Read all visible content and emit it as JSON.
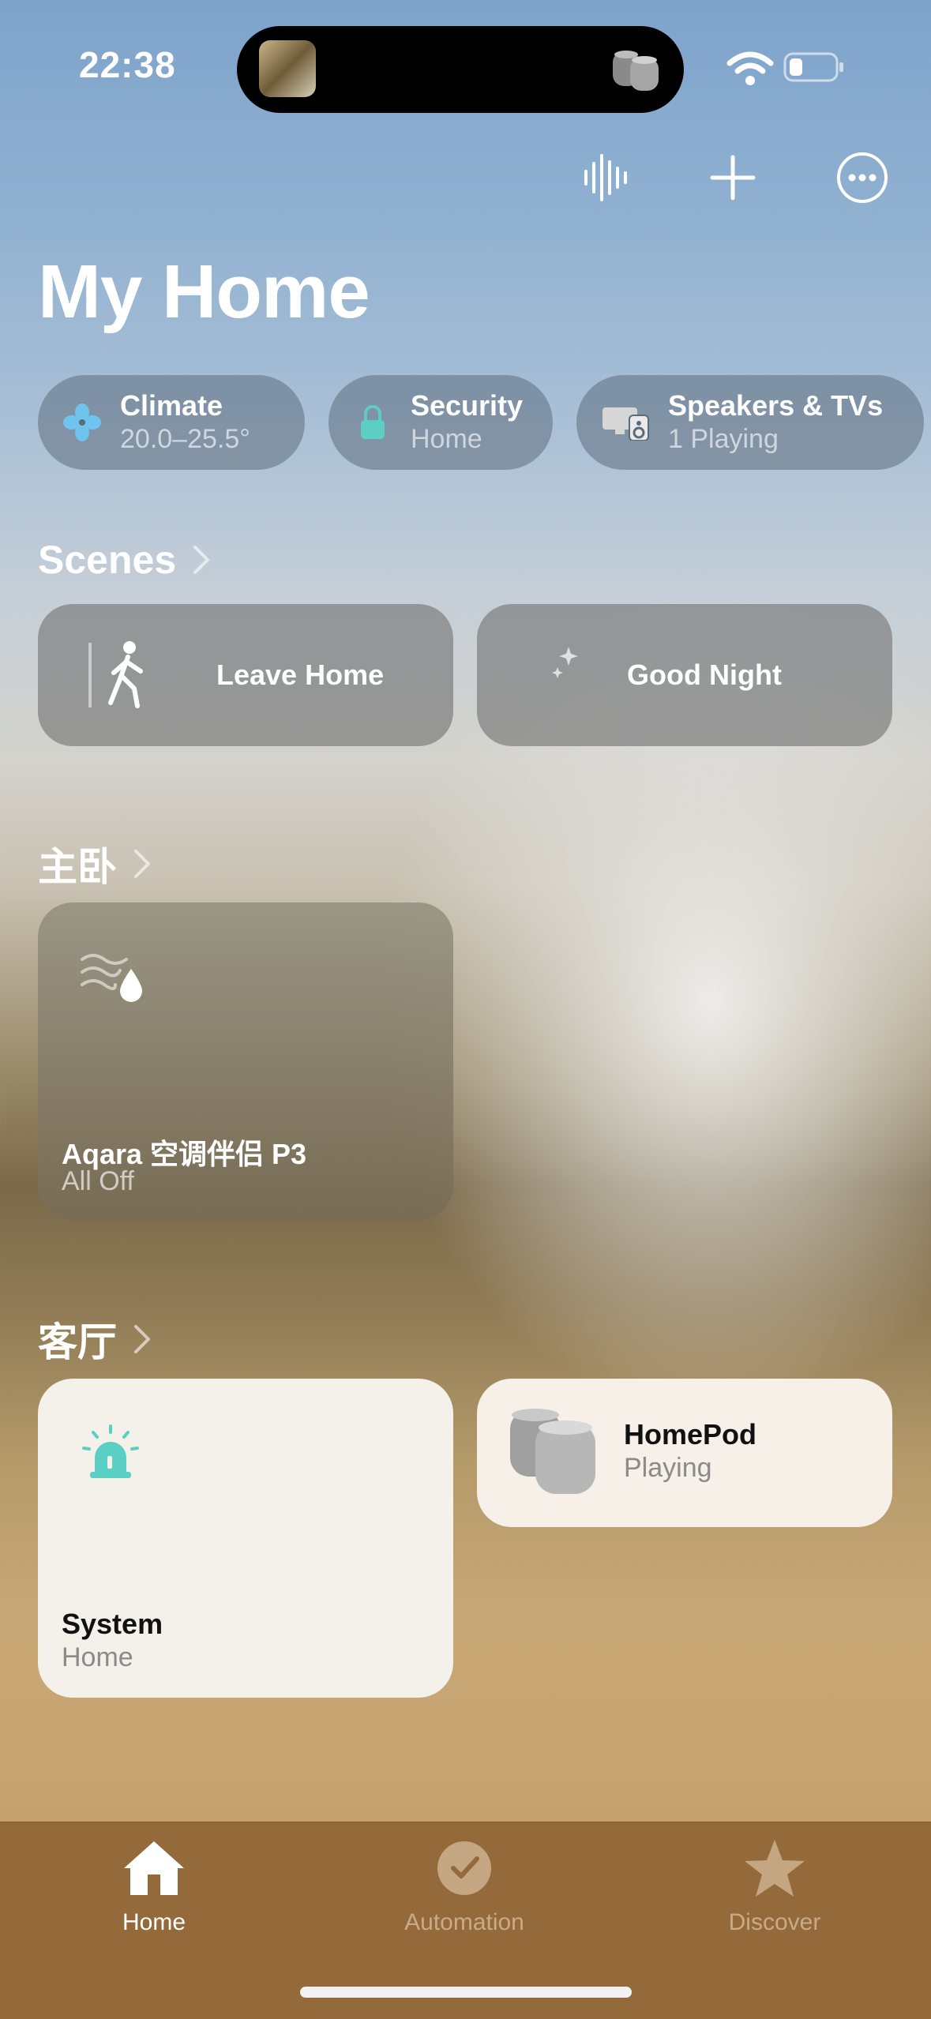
{
  "status_bar": {
    "time": "22:38"
  },
  "header": {
    "title": "My Home"
  },
  "summary_pills": [
    {
      "title": "Climate",
      "subtitle": "20.0–25.5°",
      "icon": "fan-icon"
    },
    {
      "title": "Security",
      "subtitle": "Home",
      "icon": "lock-icon"
    },
    {
      "title": "Speakers & TVs",
      "subtitle": "1 Playing",
      "icon": "speakers-tv-icon"
    }
  ],
  "scenes": {
    "title": "Scenes",
    "items": [
      {
        "label": "Leave Home",
        "icon": "walking-person-icon"
      },
      {
        "label": "Good Night",
        "icon": "moon-stars-icon"
      }
    ]
  },
  "rooms": [
    {
      "title": "主卧",
      "accessories": [
        {
          "name": "Aqara 空调伴侣 P3",
          "state": "All Off",
          "icon": "humidity-icon"
        }
      ]
    },
    {
      "title": "客厅",
      "accessories": [
        {
          "name": "System",
          "state": "Home",
          "icon": "siren-icon"
        },
        {
          "name": "HomePod",
          "state": "Playing",
          "icon": "homepod-icon"
        }
      ]
    }
  ],
  "tabbar": {
    "tabs": [
      {
        "label": "Home",
        "icon": "house-icon",
        "active": true
      },
      {
        "label": "Automation",
        "icon": "clock-check-icon",
        "active": false
      },
      {
        "label": "Discover",
        "icon": "star-icon",
        "active": false
      }
    ]
  },
  "colors": {
    "accent_teal": "#5ccfc4",
    "fan_blue": "#6fc4ee",
    "tabbar_bg": "#946a3a"
  }
}
